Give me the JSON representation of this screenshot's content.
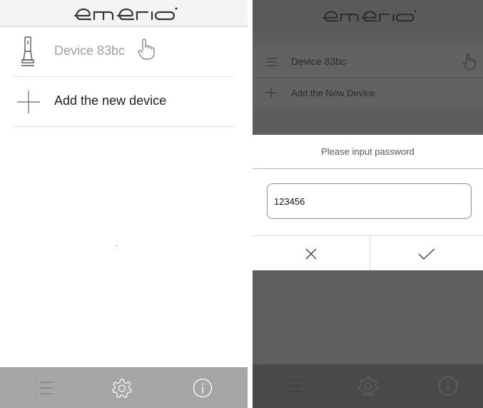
{
  "brand": {
    "logo_text": "emerio",
    "registered": "®"
  },
  "left_screen": {
    "devices": [
      {
        "name": "Device 83bc"
      }
    ],
    "add_device_label": "Add the new device",
    "tabs": [
      {
        "icon": "list-icon"
      },
      {
        "icon": "gear-icon"
      },
      {
        "icon": "info-icon"
      }
    ]
  },
  "right_screen": {
    "devices": [
      {
        "name": "Device 83bc"
      }
    ],
    "add_device_label": "Add the New Device",
    "dialog": {
      "title": "Please input password",
      "password_value": "123456",
      "cancel_icon": "close-icon",
      "confirm_icon": "check-icon"
    }
  },
  "colors": {
    "tabbar": "#a6a6a6",
    "overlay": "#5e5e5e",
    "dialog_bg": "#ffffff"
  }
}
